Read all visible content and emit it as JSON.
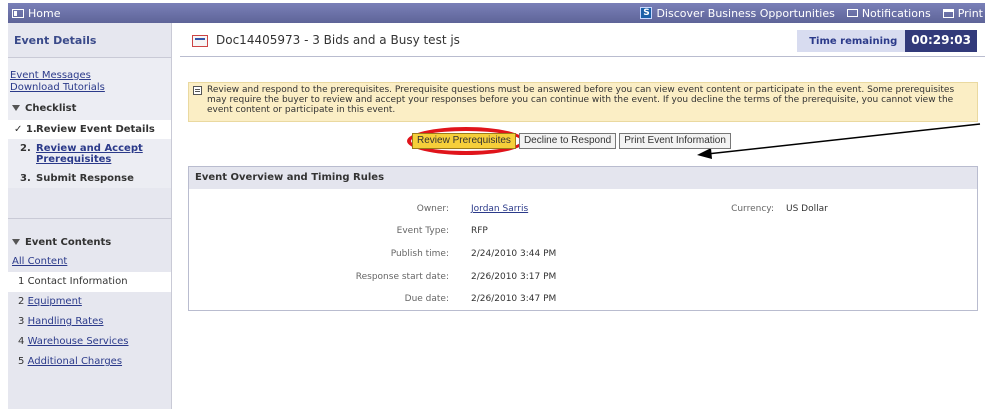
{
  "topbar": {
    "home_label": "Home",
    "discover_label": "Discover Business Opportunities",
    "notifications_label": "Notifications",
    "print_label": "Print"
  },
  "sidebar": {
    "title": "Event Details",
    "links": [
      "Event Messages",
      "Download Tutorials"
    ],
    "checklist_label": "Checklist",
    "checklist": [
      {
        "num": "✓ 1.",
        "label": "Review Event Details"
      },
      {
        "num": "2.",
        "label": "Review and Accept Prerequisites"
      },
      {
        "num": "3.",
        "label": "Submit Response"
      }
    ],
    "contents_label": "Event Contents",
    "all_content": "All Content",
    "contents": [
      {
        "num": "1",
        "label": "Contact Information"
      },
      {
        "num": "2",
        "label": "Equipment"
      },
      {
        "num": "3",
        "label": "Handling Rates"
      },
      {
        "num": "4",
        "label": "Warehouse Services"
      },
      {
        "num": "5",
        "label": "Additional Charges"
      }
    ]
  },
  "main": {
    "title": "Doc14405973 - 3 Bids and a Busy test js",
    "time_label": "Time remaining",
    "time_value": "00:29:03",
    "note": "Review and respond to the prerequisites. Prerequisite questions must be answered before you can view event content or participate in the event. Some prerequisites may require the buyer to review and accept your responses before you can continue with the event. If you decline the terms of the prerequisite, you cannot view the event content or participate in this event.",
    "buttons": {
      "review": "Review Prerequisites",
      "decline": "Decline to Respond",
      "print": "Print Event Information"
    },
    "panel_title": "Event Overview and Timing Rules",
    "fields": {
      "owner_label": "Owner:",
      "owner_value": "Jordan Sarris",
      "currency_label": "Currency:",
      "currency_value": "US Dollar",
      "type_label": "Event Type:",
      "type_value": "RFP",
      "publish_label": "Publish time:",
      "publish_value": "2/24/2010 3:44 PM",
      "start_label": "Response start date:",
      "start_value": "2/26/2010 3:17 PM",
      "due_label": "Due date:",
      "due_value": "2/26/2010 3:47 PM"
    }
  },
  "colors": {
    "topbar": "#6a70a8",
    "highlight": "#e0141b",
    "primary_button": "#f6cf3a",
    "note_bg": "#fbeec5"
  }
}
